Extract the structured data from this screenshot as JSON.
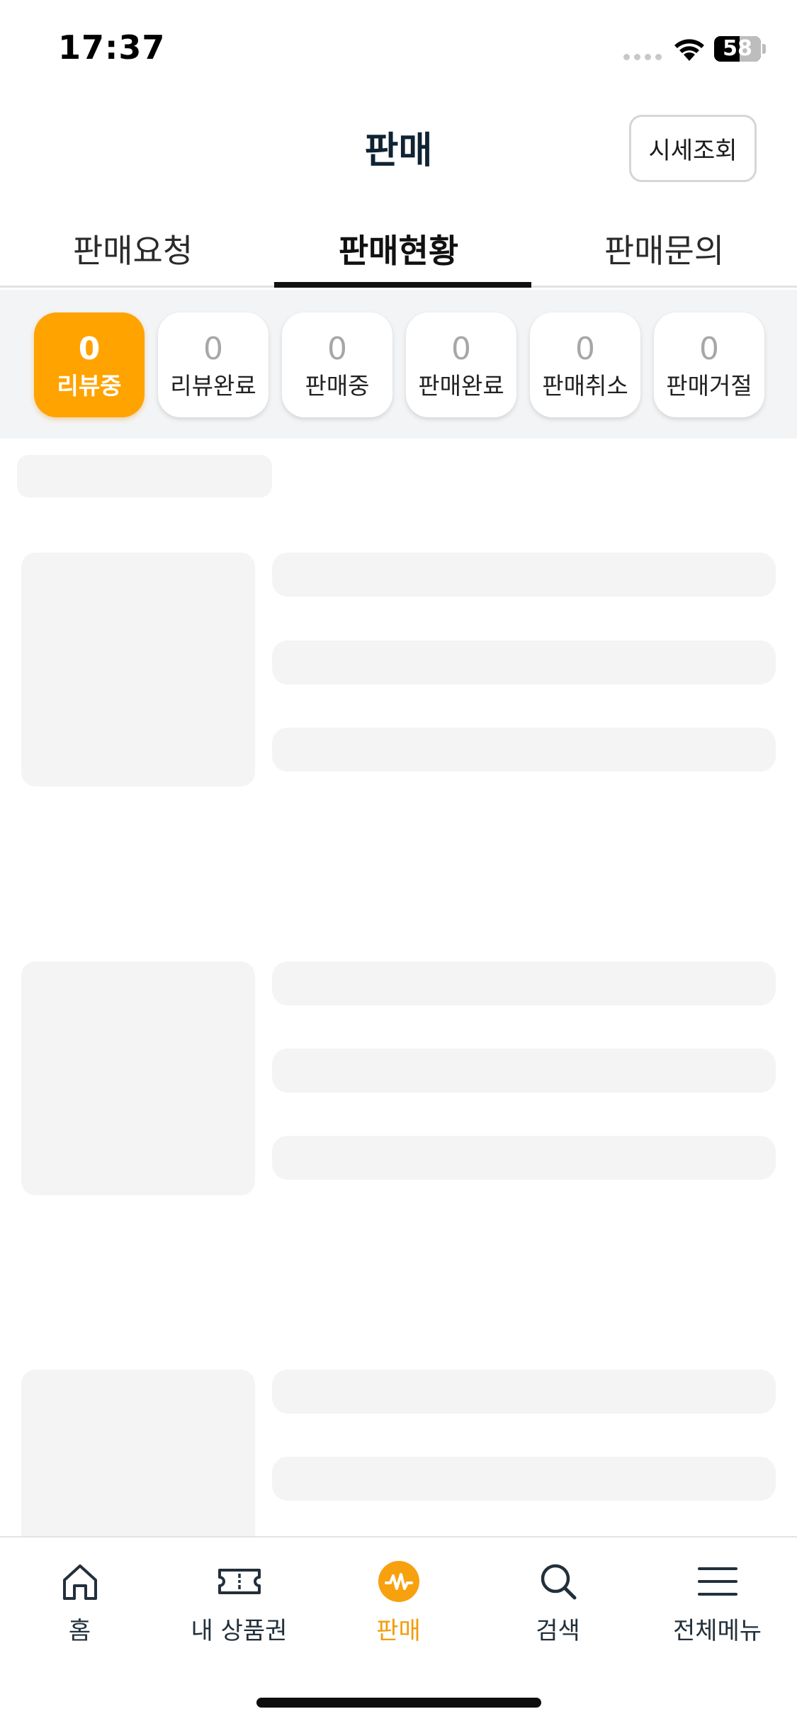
{
  "status_bar": {
    "time": "17:37",
    "battery": "58"
  },
  "header": {
    "title": "판매",
    "price_button": "시세조회"
  },
  "tabs": [
    {
      "label": "판매요청",
      "active": false
    },
    {
      "label": "판매현황",
      "active": true
    },
    {
      "label": "판매문의",
      "active": false
    }
  ],
  "filters": [
    {
      "count": "0",
      "label": "리뷰중",
      "active": true
    },
    {
      "count": "0",
      "label": "리뷰완료",
      "active": false
    },
    {
      "count": "0",
      "label": "판매중",
      "active": false
    },
    {
      "count": "0",
      "label": "판매완료",
      "active": false
    },
    {
      "count": "0",
      "label": "판매취소",
      "active": false
    },
    {
      "count": "0",
      "label": "판매거절",
      "active": false
    }
  ],
  "bottom_nav": [
    {
      "label": "홈",
      "icon": "home-icon",
      "active": false
    },
    {
      "label": "내 상품권",
      "icon": "ticket-icon",
      "active": false
    },
    {
      "label": "판매",
      "icon": "won-sell-icon",
      "active": true
    },
    {
      "label": "검색",
      "icon": "search-icon",
      "active": false
    },
    {
      "label": "전체메뉴",
      "icon": "menu-icon",
      "active": false
    }
  ],
  "colors": {
    "accent": "#ffa300",
    "active_nav": "#f29c0b",
    "skeleton": "#f4f4f5",
    "filter_bg": "#f3f4f6"
  }
}
